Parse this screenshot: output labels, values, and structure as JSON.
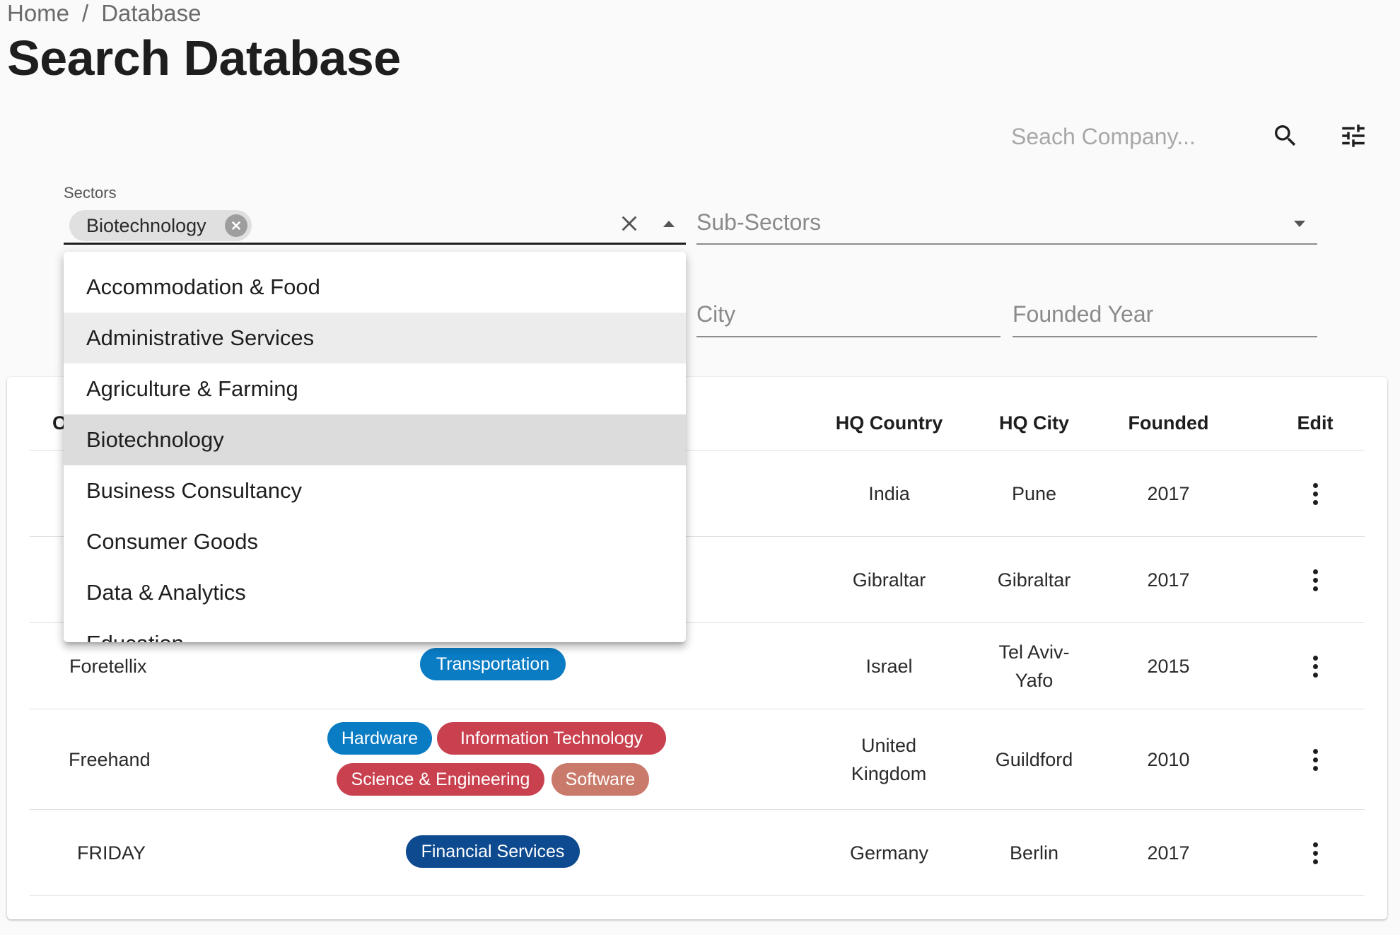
{
  "breadcrumb": {
    "home": "Home",
    "separator": "/",
    "current": "Database"
  },
  "page_title": "Search Database",
  "search": {
    "placeholder": "Seach Company...",
    "search_icon": "search-icon",
    "filter_icon": "tune-icon"
  },
  "filters": {
    "sectors": {
      "label": "Sectors",
      "chip": "Biotechnology"
    },
    "sub_sectors": {
      "placeholder": "Sub-Sectors"
    },
    "city": {
      "placeholder": "City"
    },
    "founded_year": {
      "placeholder": "Founded Year"
    }
  },
  "dropdown": {
    "options": [
      "Accommodation & Food",
      "Administrative Services",
      "Agriculture & Farming",
      "Biotechnology",
      "Business Consultancy",
      "Consumer Goods",
      "Data & Analytics",
      "Education"
    ],
    "hovered": "Administrative Services",
    "selected": "Biotechnology"
  },
  "table": {
    "columns": {
      "company_partial": "O",
      "hq_country": "HQ Country",
      "hq_city": "HQ City",
      "founded": "Founded",
      "edit": "Edit"
    },
    "rows": [
      {
        "name": "",
        "tags": [],
        "country": "India",
        "city": "Pune",
        "founded": "2017"
      },
      {
        "name": "",
        "tags": [],
        "country": "Gibraltar",
        "city": "Gibraltar",
        "founded": "2017"
      },
      {
        "name": "Foretellix",
        "tags": [
          "Transportation"
        ],
        "country": "Israel",
        "city": "Tel Aviv-Yafo",
        "founded": "2015"
      },
      {
        "name": "Freehand",
        "tags": [
          "Hardware",
          "Information Technology",
          "Science & Engineering",
          "Software"
        ],
        "country": "United Kingdom",
        "city": "Guildford",
        "founded": "2010"
      },
      {
        "name": "FRIDAY",
        "tags": [
          "Financial Services"
        ],
        "country": "Germany",
        "city": "Berlin",
        "founded": "2017"
      }
    ]
  },
  "colors": {
    "tag_transportation": "#0a7cc4",
    "tag_hardware": "#0a7cc4",
    "tag_information_technology": "#c9414f",
    "tag_science_engineering": "#c9414f",
    "tag_software": "#c97a6a",
    "tag_financial_services": "#0d4a8f"
  }
}
